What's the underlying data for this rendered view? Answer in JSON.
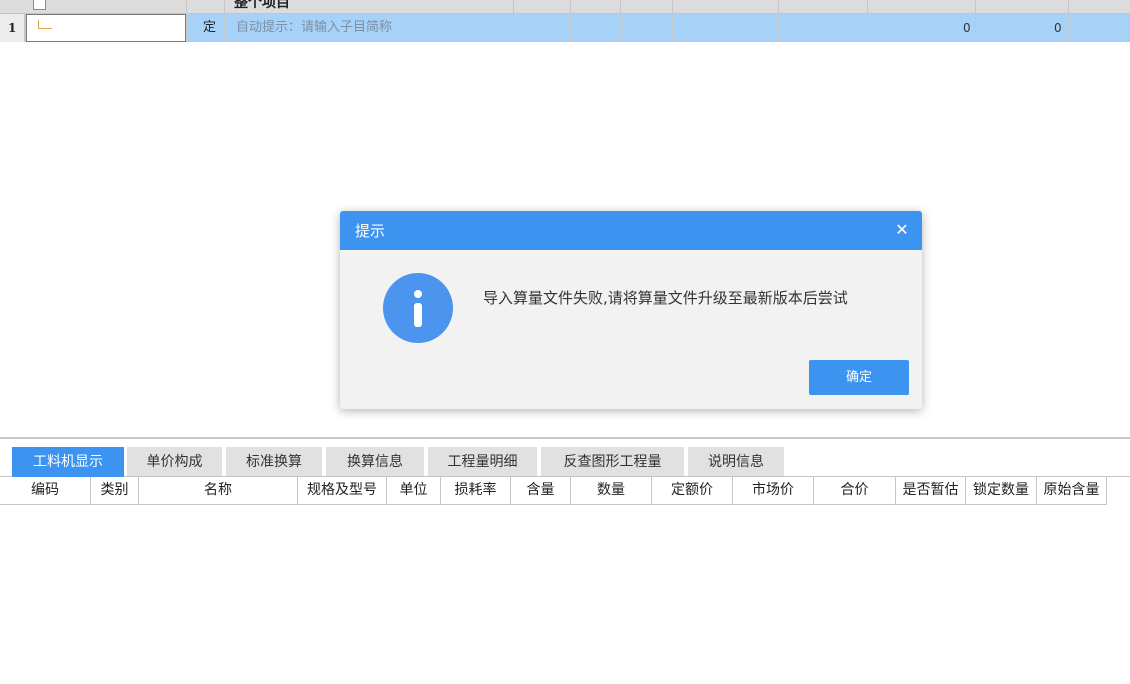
{
  "top_grid": {
    "header_title": "整个项目",
    "row": {
      "row_number": "1",
      "type": "定",
      "hint": "自动提示：请输入子目简称",
      "value_1": "0",
      "value_2": "0"
    }
  },
  "dialog": {
    "title": "提示",
    "close_glyph": "✕",
    "icon": "info-icon",
    "message": "导入算量文件失败,请将算量文件升级至最新版本后尝试",
    "ok_label": "确定"
  },
  "bottom_panel": {
    "tabs": [
      {
        "label": "工料机显示",
        "active": true
      },
      {
        "label": "单价构成",
        "active": false
      },
      {
        "label": "标准换算",
        "active": false
      },
      {
        "label": "换算信息",
        "active": false
      },
      {
        "label": "工程量明细",
        "active": false
      },
      {
        "label": "反查图形工程量",
        "active": false
      },
      {
        "label": "说明信息",
        "active": false
      }
    ],
    "columns": [
      "编码",
      "类别",
      "名称",
      "规格及型号",
      "单位",
      "损耗率",
      "含量",
      "数量",
      "定额价",
      "市场价",
      "合价",
      "是否暂估",
      "锁定数量",
      "原始含量"
    ]
  },
  "colors": {
    "accent": "#3d93f0",
    "selected_row": "#a6d2f8",
    "dialog_bg": "#f2f2f2",
    "hint_text": "#7e8fa6"
  }
}
